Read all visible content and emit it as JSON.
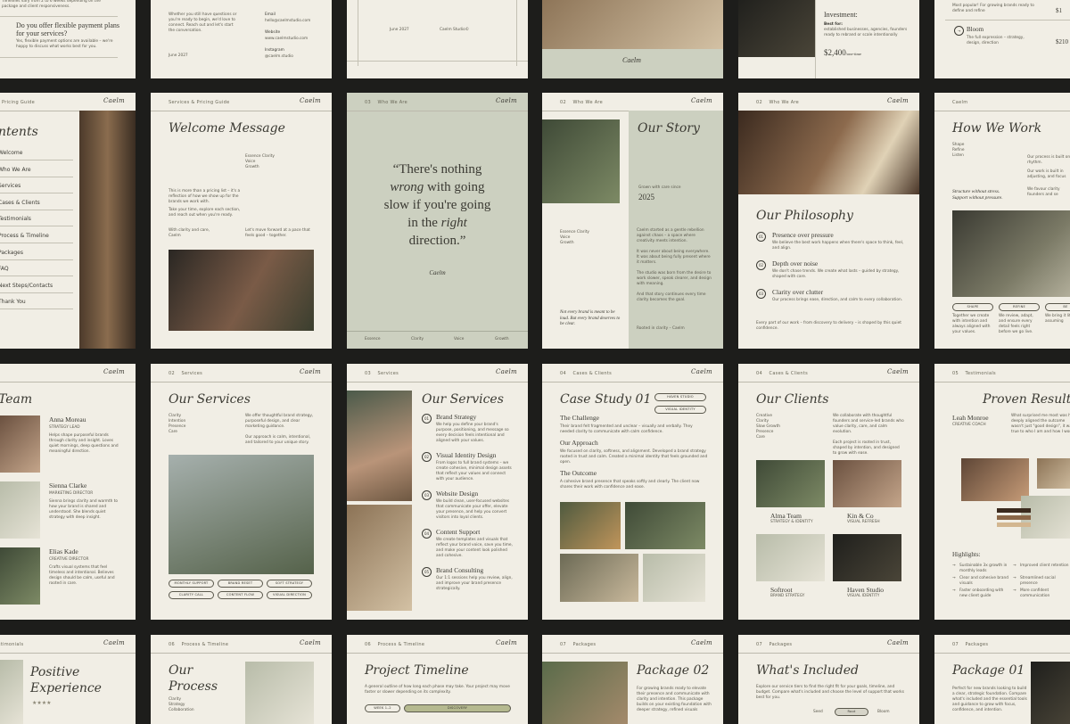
{
  "colors": {
    "background": "#1d1d1b",
    "page": "#f1eee5",
    "sage": "#ccd0c0",
    "ink": "#3b3a33"
  },
  "brand": "Caelm",
  "row1": {
    "p1": {
      "text1": "Timelines vary from 2 to 6 weeks depending on the package and client responsiveness.",
      "q": "Do you offer flexible payment plans for your services?",
      "a": "Yes, flexible payment options are available – we're happy to discuss what works best for you."
    },
    "p2": {
      "body": "Whether you still have questions or you're ready to begin, we'd love to connect. Reach out and let's start the conversation.",
      "date": "June 2027",
      "email_label": "Email",
      "email": "hello@caelmstudio.com",
      "web_label": "Website",
      "web": "www.caelmstudio.com",
      "insta_label": "Instagram",
      "insta": "@caelm.studio"
    },
    "p3": {
      "date": "June 2027",
      "studio": "Caelm Studio©"
    },
    "p5": {
      "inv_label": "Investment:",
      "best_label": "Best for:",
      "best": "established businesses, agencies, founders ready to rebrand or scale intentionally",
      "price": "$2,400",
      "price_suffix": "/one-time"
    },
    "p6": {
      "top": "Most popular! For growing brands ready to define and refine",
      "bloom": "Bloom",
      "bloom_desc": "The full expression – strategy, design, direction",
      "price_a": "$1",
      "price_b": "$210"
    }
  },
  "row2": {
    "p1": {
      "hdr": "Pricing Guide",
      "title": "ntents",
      "items": [
        "Welcome",
        "Who We Are",
        "Services",
        "Cases & Clients",
        "Testimonials",
        "Process & Timeline",
        "Packages",
        "FAQ",
        "Next Steps/Contacts",
        "Thank You"
      ]
    },
    "p2": {
      "hdr": "Services & Pricing Guide",
      "title": "Welcome Message",
      "tags": "Essence Clarity\nVoice\nGrowth",
      "body1": "This is more than a pricing list – it's a reflection of how we show up for the brands we work with.",
      "body2": "Take your time, explore each section, and reach out when you're ready.",
      "sign": "With clarity and care,\nCaelm",
      "side": "Let's move forward at a pace that feels good – together."
    },
    "p3": {
      "hdr_num": "03",
      "hdr": "Who We Are",
      "q1": "“There's nothing",
      "q2a": "wrong",
      "q2b": " with going",
      "q3": "slow if you're going",
      "q4a": "in the ",
      "q4b": "right",
      "q5": "direction.”",
      "sig": "Caelm",
      "foot": [
        "Essence",
        "Clarity",
        "Voice",
        "Growth"
      ]
    },
    "p4": {
      "hdr_num": "02",
      "hdr": "Who We Are",
      "title": "Our Story",
      "grown": "Grown with care since",
      "year": "2025",
      "tags": "Essence Clarity\nVoice\nGrowth",
      "body": "Caelm started as a gentle rebellion against chaos – a space where creativity meets intention.\n\nIt was never about being everywhere. It was about being fully present where it matters.\n\nThe studio was born from the desire to work slower, speak clearer, and design with meaning.\n\nAnd that story continues every time clarity becomes the goal.",
      "quote": "Not every brand is meant to be loud. But every brand deserves to be clear.",
      "foot": "Rooted in clarity – Caelm"
    },
    "p5": {
      "hdr_num": "02",
      "hdr": "Who We Are",
      "title": "Our Philosophy",
      "items": [
        {
          "t": "Presence over pressure",
          "d": "We believe the best work happens when there's space to think, feel, and align."
        },
        {
          "t": "Depth over noise",
          "d": "We don't chase trends. We create what lasts – guided by strategy, shaped with care."
        },
        {
          "t": "Clarity over clutter",
          "d": "Our process brings ease, direction, and calm to every collaboration."
        }
      ],
      "foot": "Every part of our work – from discovery to delivery – is shaped by this quiet confidence."
    },
    "p6": {
      "title": "How We Work",
      "tags": "Shape\nRefine\nListen",
      "stress": "Structure without stress.\nSupport without pressure.",
      "b1": "Our process is built on rhythm.",
      "b2": "Our work is built in adjusting, and focus",
      "b3": "We favour clarity founders and se",
      "pills": [
        "SHAPE",
        "REFINE",
        "BE"
      ],
      "c1": "Together we create with intention and always aligned with your values.",
      "c2": "We review, adapt, and ensure every detail feels right before we go live.",
      "c3": "We bring it life assuming"
    }
  },
  "row3": {
    "p1": {
      "title": "Team",
      "members": [
        {
          "n": "Anna Moreau",
          "r": "STRATEGY LEAD",
          "d": "Helps shape purposeful brands through clarity and insight. Loves quiet mornings, deep questions and meaningful direction."
        },
        {
          "n": "Sienna Clarke",
          "r": "MARKETING DIRECTOR",
          "d": "Sienna brings clarity and warmth to how your brand is shared and understood. She blends quiet strategy with deep insight."
        },
        {
          "n": "Elias Kade",
          "r": "CREATIVE DIRECTOR",
          "d": "Crafts visual systems that feel timeless and intentional. Believes design should be calm, useful and rooted in care."
        }
      ]
    },
    "p2": {
      "hdr_num": "02",
      "hdr": "Services",
      "title": "Our Services",
      "tags": "Clarity\nIntention\nPresence\nCare",
      "body": "We offer thoughtful brand strategy, purposeful design, and clear marketing guidance.\n\nOur approach is calm, intentional, and tailored to your unique story.",
      "pills": [
        "MONTHLY SUPPORT",
        "BRAND RESET",
        "SOFT STRATEGY",
        "CLARITY CALL",
        "CONTENT FLOW",
        "VISUAL DIRECTION"
      ]
    },
    "p3": {
      "hdr_num": "03",
      "hdr": "Services",
      "title": "Our Services",
      "items": [
        {
          "t": "Brand Strategy",
          "d": "We help you define your brand's purpose, positioning, and message so every decision feels intentional and aligned with your values."
        },
        {
          "t": "Visual Identity Design",
          "d": "From logos to full brand systems – we create cohesive, minimal design assets that reflect your values and connect with your audience."
        },
        {
          "t": "Website Design",
          "d": "We build clean, user-focused websites that communicate your offer, elevate your presence, and help you convert visitors into loyal clients."
        },
        {
          "t": "Content Support",
          "d": "We create templates and visuals that reflect your brand voice, save you time, and make your content look polished and cohesive."
        },
        {
          "t": "Brand Consulting",
          "d": "Our 1:1 sessions help you review, align, and improve your brand presence strategically."
        }
      ]
    },
    "p4": {
      "hdr_num": "04",
      "hdr": "Cases & Clients",
      "title": "Case Study 01",
      "tag1": "HAVEN STUDIO",
      "tag2": "VISUAL IDENTITY",
      "s1": "The Challenge",
      "d1": "Their brand felt fragmented and unclear – visually and verbally. They needed clarity to communicate with calm confidence.",
      "s2": "Our Approach",
      "d2": "We focused on clarity, softness, and alignment. Developed a brand strategy rooted in trust and calm. Created a minimal identity that feels grounded and open.",
      "s3": "The Outcome",
      "d3": "A cohesive brand presence that speaks softly and clearly. The client now shares their work with confidence and ease."
    },
    "p5": {
      "hdr_num": "04",
      "hdr": "Cases & Clients",
      "title": "Our Clients",
      "tags": "Creative\nClarity\nSlow Growth\nPresence\nCare",
      "body": "We collaborate with thoughtful founders and service-led brands who value clarity, care, and calm evolution.\n\nEach project is rooted in trust, shaped by intention, and designed to grow with ease.",
      "clients": [
        {
          "n": "Alma Team",
          "r": "STRATEGY & IDENTITY"
        },
        {
          "n": "Kin & Co",
          "r": "VISUAL REFRESH"
        },
        {
          "n": "Softroot",
          "r": "BRAND STRATEGY"
        },
        {
          "n": "Haven Studio",
          "r": "VISUAL IDENTITY"
        }
      ]
    },
    "p6": {
      "hdr_num": "05",
      "hdr": "Testimonials",
      "title": "Proven Results",
      "name": "Leah Monroe",
      "role": "CREATIVE COACH",
      "body": "What surprised me most was how deeply aligned the outcome wasn't just \"good design\", it was true to who I am and how I work.",
      "hl": "Highlights:",
      "items": [
        "Sustainable 3x growth in monthly leads",
        "Clear and cohesive brand visuals",
        "Faster onboarding with new client guide",
        "Improved client retention",
        "Streamlined social presence",
        "More confident communication"
      ]
    }
  },
  "row4": {
    "p1": {
      "title1": "Positive",
      "title2": "Experience",
      "stars": "★★★★"
    },
    "p2": {
      "hdr_num": "06",
      "hdr": "Process & Timeline",
      "title1": "Our",
      "title2": "Process",
      "tags": "Clarity\nStrategy\nCollaboration"
    },
    "p3": {
      "hdr_num": "06",
      "hdr": "Process & Timeline",
      "title": "Project Timeline",
      "body": "A general outline of how long each phase may take. Your project may move faster or slower depending on its complexity.",
      "week": "WEEK 1–2",
      "phase": "DISCOVERY"
    },
    "p4": {
      "hdr_num": "07",
      "hdr": "Packages",
      "title": "Package 02",
      "body": "For growing brands ready to elevate their presence and communicate with clarity and intention. This package builds on your existing foundation with deeper strategy, refined visuals"
    },
    "p5": {
      "hdr_num": "07",
      "hdr": "Packages",
      "title": "What's Included",
      "body": "Explore our service tiers to find the right fit for your goals, timeline, and budget. Compare what's included and choose the level of support that works best for you.",
      "tabs": [
        "Seed",
        "Root",
        "Bloom"
      ]
    },
    "p6": {
      "hdr_num": "07",
      "hdr": "Packages",
      "title": "Package 01",
      "body": "Perfect for new brands looking to build a clear, strategic foundation. Compare what's included and the essential tools and guidance to grow with focus, confidence, and intention."
    }
  }
}
